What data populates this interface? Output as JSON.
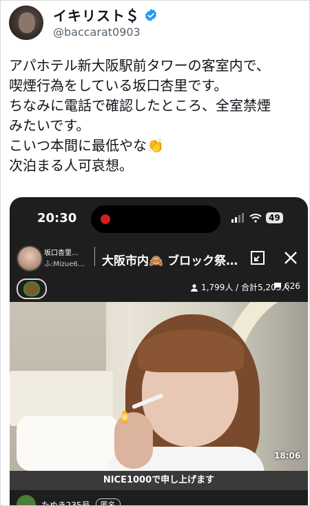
{
  "tweet": {
    "author_name": "イキリスト＄",
    "handle": "@baccarat0903",
    "text": "アパホテル新大阪駅前タワーの客室内で、\n喫煙行為をしている坂口杏里です。\nちなみに電話で確認したところ、全室禁煙\nみたいです。\nこいつ本間に最低やな👏\n次泊まる人可哀想。"
  },
  "media": {
    "status_bar": {
      "time": "20:30",
      "battery": "49"
    },
    "live": {
      "streamer_name": "坂口杏里…",
      "streamer_sub": "ふ:Mizue6…",
      "title": "大阪市内🙈 ブロック祭…",
      "viewers": "1,799人 / 合計5,203人",
      "comments": "626",
      "duration": "18:06",
      "gift_banner": "NICE1000で申し上げます",
      "commenter_name": "たぬき235号",
      "commenter_badge": "匿名"
    }
  },
  "colors": {
    "verified": "#1d9bf0",
    "record": "#d21f1f",
    "text": "#0f1419",
    "handle": "#536471"
  },
  "icons": [
    "verified-badge-icon",
    "signal-icon",
    "wifi-icon",
    "battery-icon",
    "pip-icon",
    "close-icon",
    "user-icon",
    "comment-icon"
  ]
}
